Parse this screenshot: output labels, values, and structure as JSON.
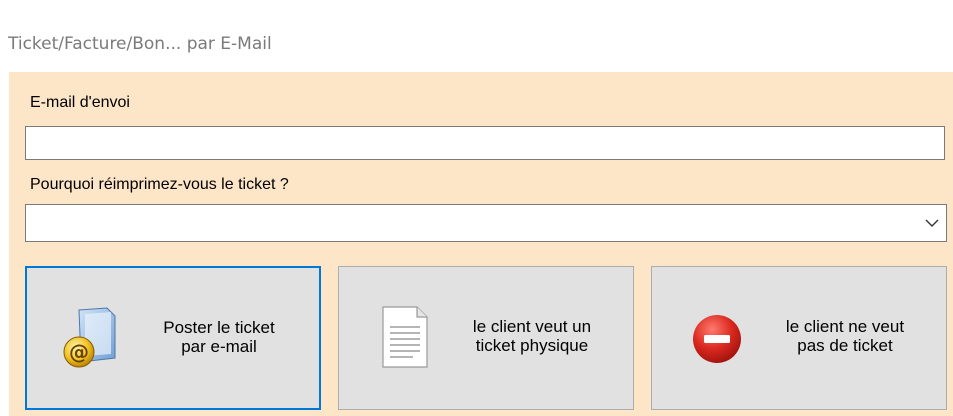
{
  "window": {
    "title": "Ticket/Facture/Bon...  par E-Mail"
  },
  "form": {
    "email_label": "E-mail d'envoi",
    "email_value": "",
    "reason_label": "Pourquoi réimprimez-vous le ticket ?",
    "reason_value": ""
  },
  "buttons": [
    {
      "label": "Poster  le ticket\npar e-mail",
      "icon": "email-folder-icon"
    },
    {
      "label": "le client veut un\nticket physique",
      "icon": "document-icon"
    },
    {
      "label": "le client ne veut\npas de ticket",
      "icon": "no-entry-icon"
    }
  ],
  "colors": {
    "panel_bg": "#fde5c8",
    "button_bg": "#e1e1e1",
    "focus_border": "#0078d7",
    "stop_red": "#d9281f"
  }
}
